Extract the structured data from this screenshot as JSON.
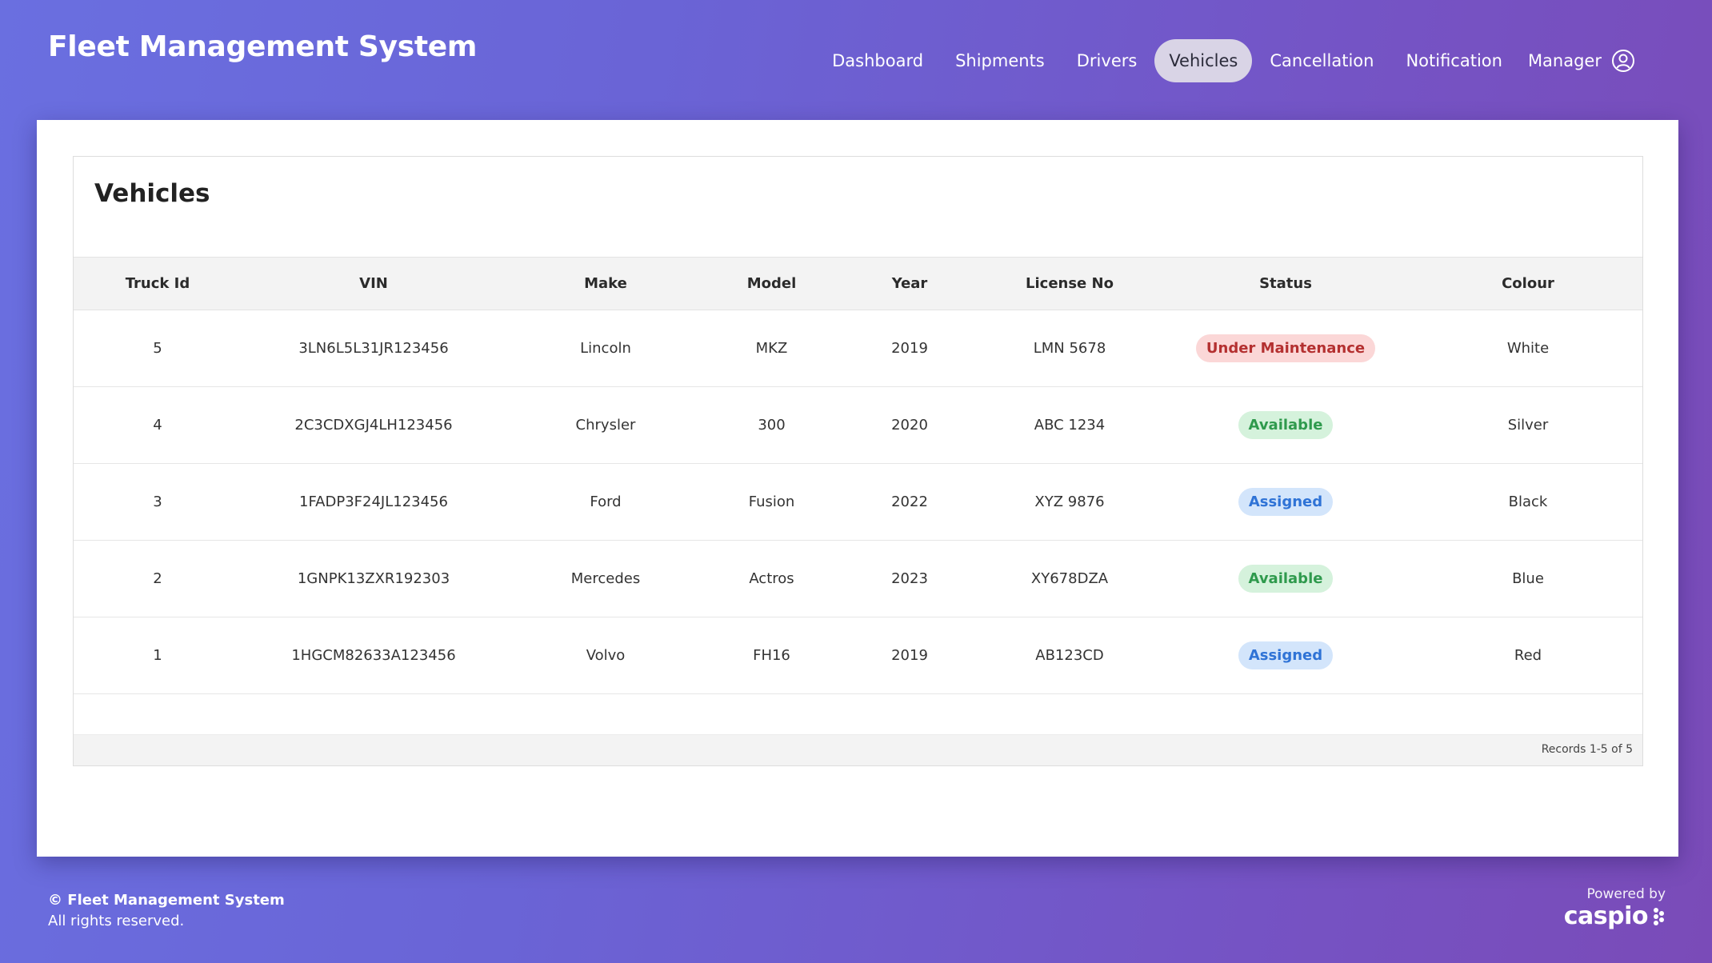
{
  "header": {
    "app_title": "Fleet Management System",
    "nav": [
      {
        "label": "Dashboard"
      },
      {
        "label": "Shipments"
      },
      {
        "label": "Drivers"
      },
      {
        "label": "Vehicles",
        "active": true
      },
      {
        "label": "Cancellation"
      },
      {
        "label": "Notification"
      }
    ],
    "user_label": "Manager",
    "user_icon": "user-circle-icon"
  },
  "main": {
    "title": "Vehicles",
    "columns": [
      "Truck Id",
      "VIN",
      "Make",
      "Model",
      "Year",
      "License No",
      "Status",
      "Colour"
    ],
    "rows": [
      {
        "truck_id": "5",
        "vin": "3LN6L5L31JR123456",
        "make": "Lincoln",
        "model": "MKZ",
        "year": "2019",
        "license": "LMN 5678",
        "status": "Under Maintenance",
        "colour": "White"
      },
      {
        "truck_id": "4",
        "vin": "2C3CDXGJ4LH123456",
        "make": "Chrysler",
        "model": "300",
        "year": "2020",
        "license": "ABC 1234",
        "status": "Available",
        "colour": "Silver"
      },
      {
        "truck_id": "3",
        "vin": "1FADP3F24JL123456",
        "make": "Ford",
        "model": "Fusion",
        "year": "2022",
        "license": "XYZ 9876",
        "status": "Assigned",
        "colour": "Black"
      },
      {
        "truck_id": "2",
        "vin": "1GNPK13ZXR192303",
        "make": "Mercedes",
        "model": "Actros",
        "year": "2023",
        "license": "XY678DZA",
        "status": "Available",
        "colour": "Blue"
      },
      {
        "truck_id": "1",
        "vin": "1HGCM82633A123456",
        "make": "Volvo",
        "model": "FH16",
        "year": "2019",
        "license": "AB123CD",
        "status": "Assigned",
        "colour": "Red"
      }
    ],
    "records_text": "Records 1-5 of 5"
  },
  "footer": {
    "copyright": "© Fleet Management System",
    "rights": "All rights reserved.",
    "powered_by": "Powered by",
    "brand": "caspio"
  },
  "colors": {
    "maintenance": "#b43030",
    "available": "#2f9a4d",
    "assigned": "#2f73d6"
  }
}
